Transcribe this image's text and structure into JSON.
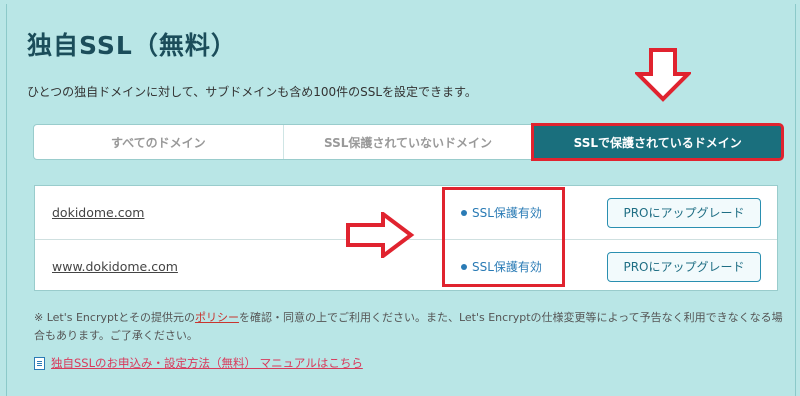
{
  "page": {
    "title": "独自SSL（無料）",
    "description": "ひとつの独自ドメインに対して、サブドメインも含め100件のSSLを設定できます。"
  },
  "tabs": [
    {
      "label": "すべてのドメイン",
      "active": false
    },
    {
      "label": "SSL保護されていないドメイン",
      "active": false
    },
    {
      "label": "SSLで保護されているドメイン",
      "active": true
    }
  ],
  "domains": [
    {
      "name": "dokidome.com",
      "status": "SSL保護有効",
      "action": "PROにアップグレード"
    },
    {
      "name": "www.dokidome.com",
      "status": "SSL保護有効",
      "action": "PROにアップグレード"
    }
  ],
  "note": {
    "prefix": "※ Let's Encryptとその提供元の",
    "link": "ポリシー",
    "suffix": "を確認・同意の上でご利用ください。また、Let's Encryptの仕様変更等によって予告なく利用できなくなる場合もあります。ご了承ください。"
  },
  "manual_link": "独自SSLのお申込み・設定方法（無料） マニュアルはこちら",
  "colors": {
    "background": "#b9e6e6",
    "active_tab": "#1a6f7d",
    "annotation_red": "#e0232f",
    "status_blue": "#2a7bb5"
  },
  "icons": [
    "arrow-down-icon",
    "arrow-right-icon",
    "status-dot-icon",
    "document-icon"
  ]
}
